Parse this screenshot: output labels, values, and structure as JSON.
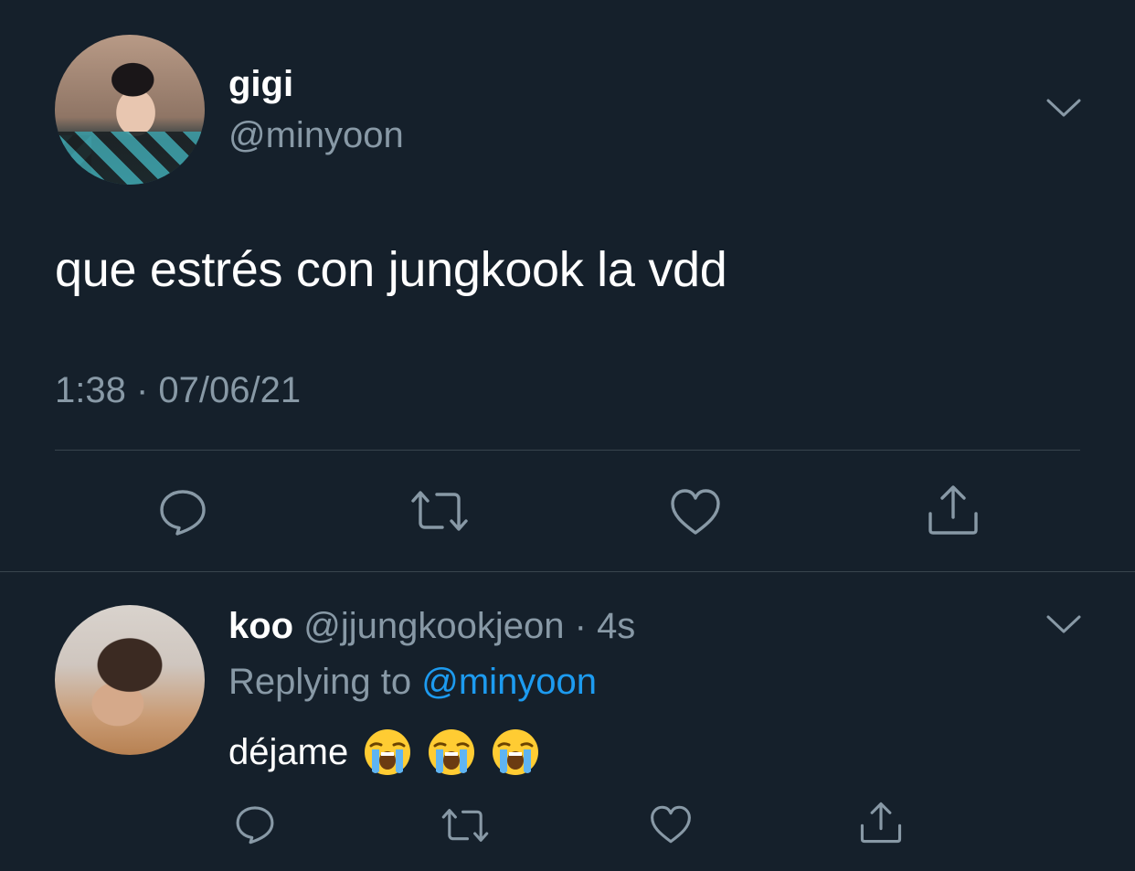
{
  "main_tweet": {
    "display_name": "gigi",
    "handle": "@minyoon",
    "text": "que estrés con jungkook la vdd",
    "timestamp": "1:38 · 07/06/21"
  },
  "reply": {
    "display_name": "koo",
    "handle": "@jjungkookjeon",
    "separator": "·",
    "time": "4s",
    "replying_prefix": "Replying to",
    "replying_mention": "@minyoon",
    "text": "déjame",
    "emoji_name": "loudly-crying-face"
  },
  "icons": [
    "reply-icon",
    "retweet-icon",
    "like-icon",
    "share-icon",
    "chevron-down-icon"
  ],
  "colors": {
    "background": "#15202b",
    "divider": "#38444d",
    "secondary_text": "#8899a6",
    "link": "#1d9bf0"
  }
}
